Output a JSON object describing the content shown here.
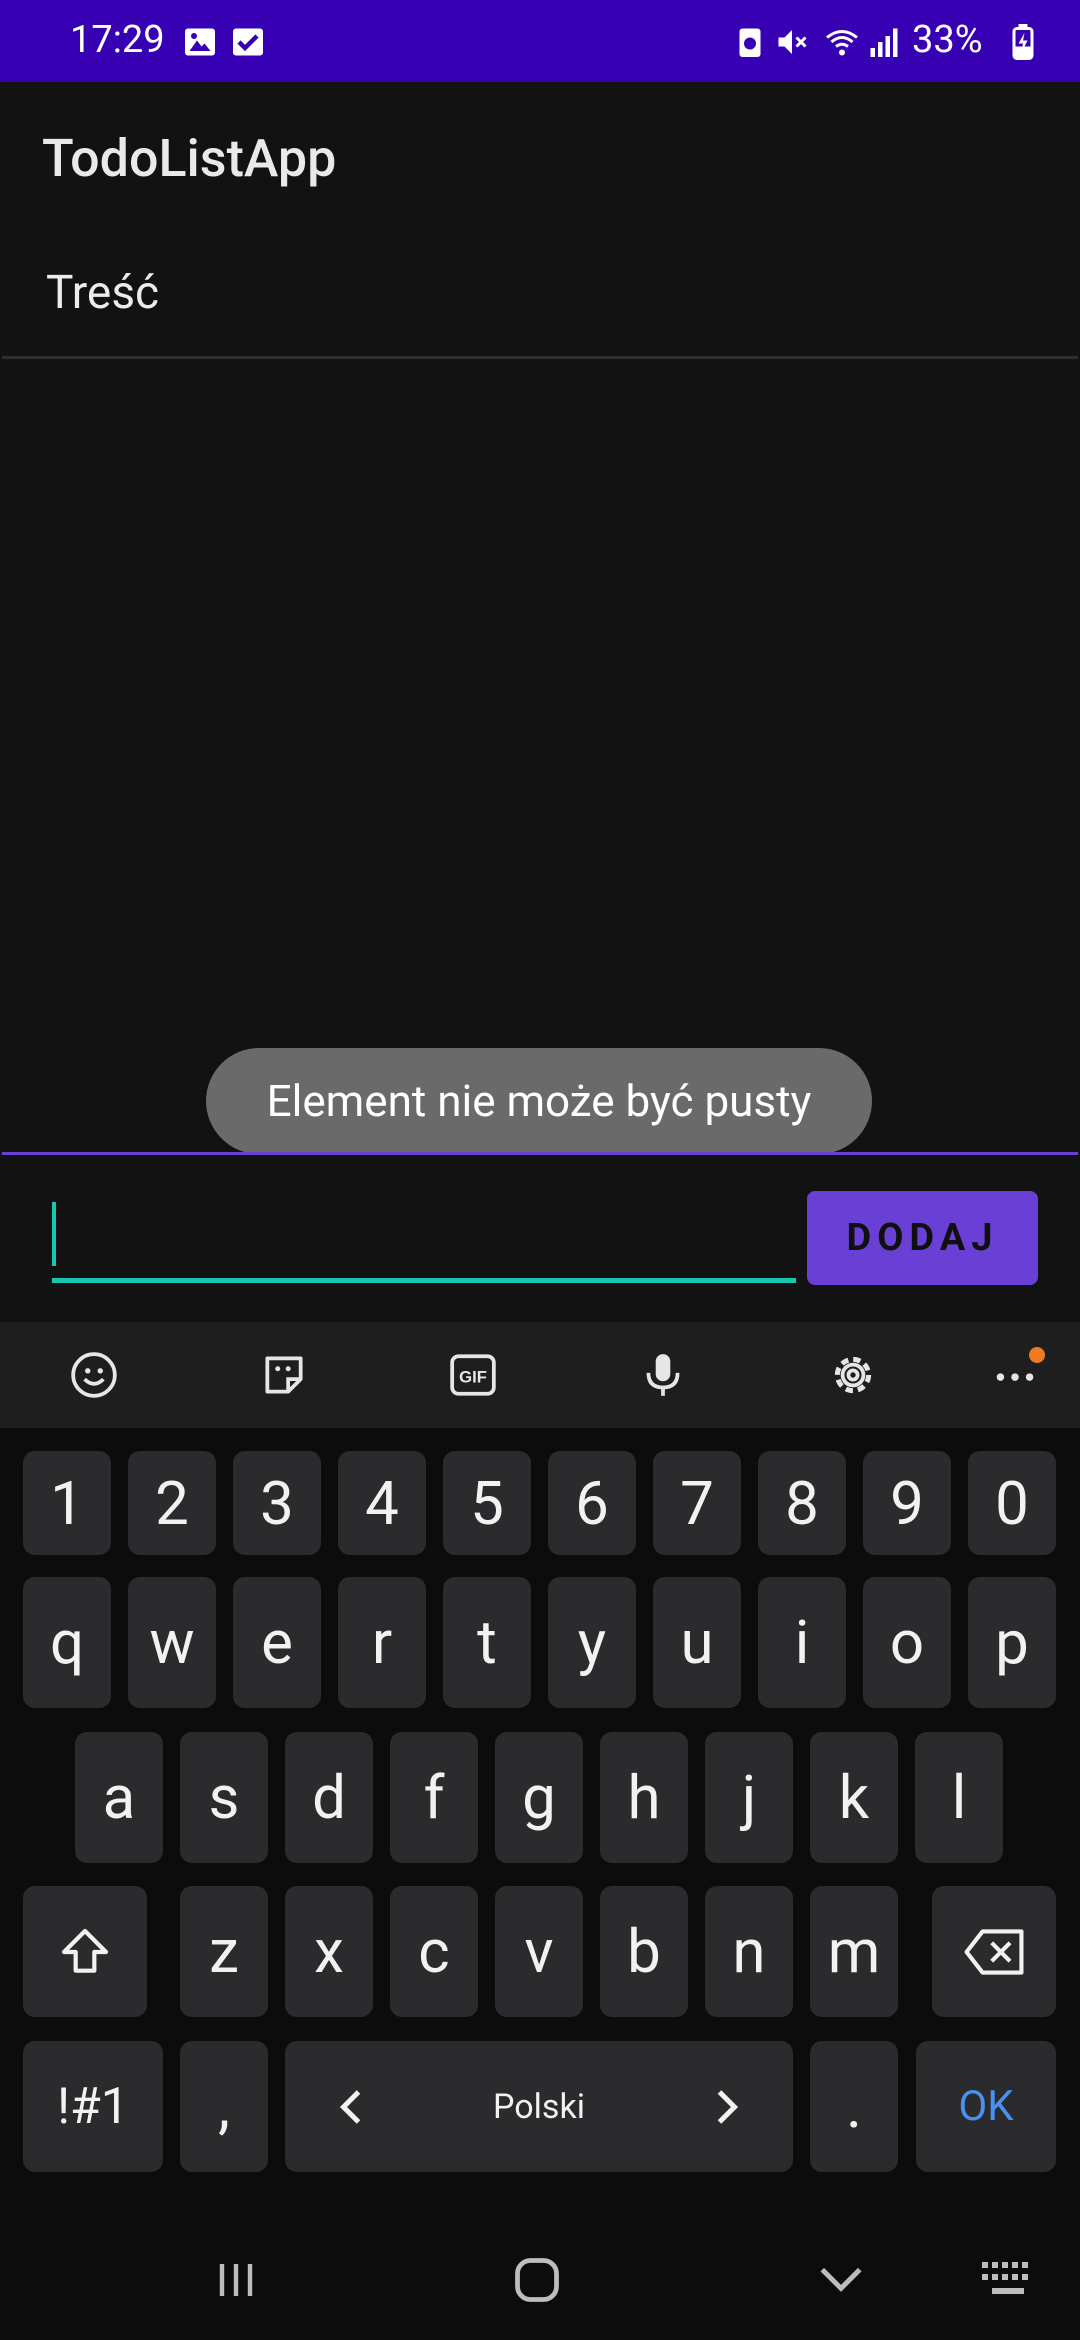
{
  "status_bar": {
    "time": "17:29",
    "battery": "33%",
    "background": "#3700B3"
  },
  "app": {
    "title": "TodoListApp",
    "header": "Treść"
  },
  "toast": {
    "message": "Element nie może być pusty"
  },
  "input": {
    "value": "",
    "add_label": "DODAJ",
    "accent": "#17c7b1",
    "button_color": "#6a3fd6"
  },
  "keyboard": {
    "toolbar_icons": [
      "emoji-icon",
      "sticker-icon",
      "gif-icon",
      "microphone-icon",
      "settings-icon",
      "more-icon"
    ],
    "row_numbers": [
      "1",
      "2",
      "3",
      "4",
      "5",
      "6",
      "7",
      "8",
      "9",
      "0"
    ],
    "row_1": [
      "q",
      "w",
      "e",
      "r",
      "t",
      "y",
      "u",
      "i",
      "o",
      "p"
    ],
    "row_2": [
      "a",
      "s",
      "d",
      "f",
      "g",
      "h",
      "j",
      "k",
      "l"
    ],
    "row_3": [
      "z",
      "x",
      "c",
      "v",
      "b",
      "n",
      "m"
    ],
    "symbols_label": "!#1",
    "comma": ",",
    "space_label": "Polski",
    "period": ".",
    "ok_label": "OK",
    "ok_color": "#4a90f0"
  },
  "nav_bar": {
    "icons": [
      "recent-apps-icon",
      "home-icon",
      "back-icon",
      "keyboard-switch-icon"
    ]
  }
}
